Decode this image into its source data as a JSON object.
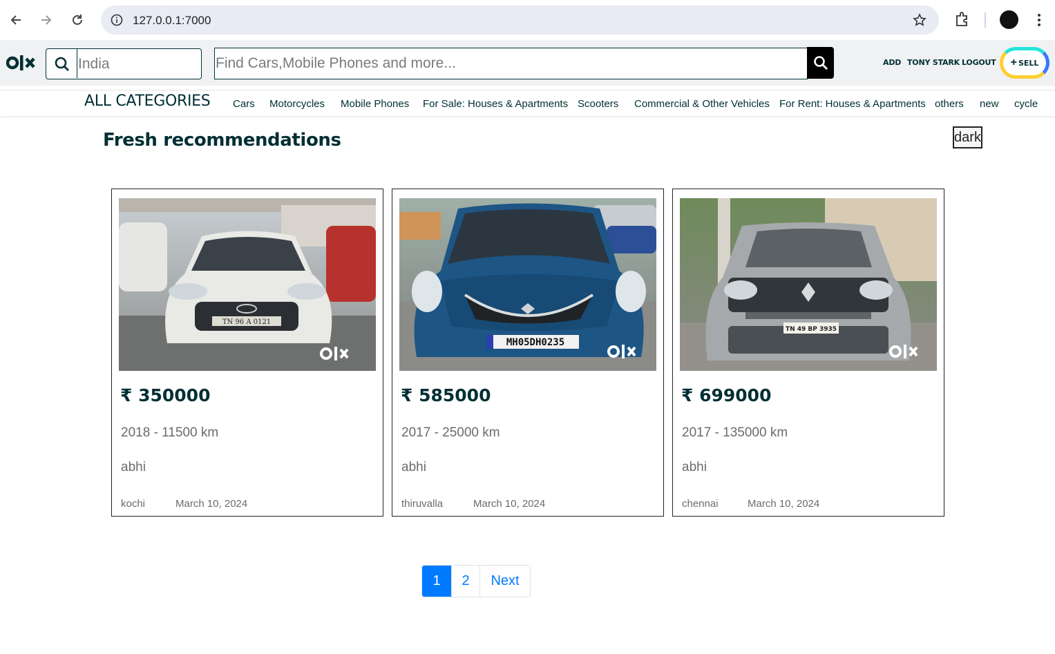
{
  "browser": {
    "url": "127.0.0.1:7000"
  },
  "header": {
    "location_value": "India",
    "search_placeholder": "Find Cars,Mobile Phones and more...",
    "links": [
      "ADD",
      "TONY STARK",
      "LOGOUT"
    ],
    "sell_label": "SELL",
    "sell_plus": "+"
  },
  "categories": {
    "all_label": "ALL CATEGORIES",
    "items": [
      "Cars",
      "Motorcycles",
      "Mobile Phones",
      "For Sale: Houses & Apartments",
      "Scooters",
      "Commercial & Other Vehicles",
      "For Rent: Houses & Apartments",
      "others",
      "new",
      "cycle"
    ]
  },
  "main": {
    "heading": "Fresh recommendations",
    "theme_button": "dark"
  },
  "listings": [
    {
      "price": "₹ 350000",
      "meta": "2018 - 11500 km",
      "owner": "abhi",
      "city": "kochi",
      "date": "March 10, 2024",
      "car_color": "#e9e9e6",
      "plate": "TN 96  A  0121",
      "brand": "hyundai"
    },
    {
      "price": "₹ 585000",
      "meta": "2017 - 25000 km",
      "owner": "abhi",
      "city": "thiruvalla",
      "date": "March 10, 2024",
      "car_color": "#1d5585",
      "plate": "MH05DH0235",
      "brand": "suzuki"
    },
    {
      "price": "₹ 699000",
      "meta": "2017 - 135000 km",
      "owner": "abhi",
      "city": "chennai",
      "date": "March 10, 2024",
      "car_color": "#a6a9ab",
      "plate": "TN 49 BP 3935",
      "brand": "renault"
    }
  ],
  "pagination": {
    "pages": [
      "1",
      "2"
    ],
    "next_label": "Next",
    "active_page": "1"
  },
  "colors": {
    "olx_dark": "#002f34",
    "pager_blue": "#007bff",
    "sell_cyan": "#23e5db",
    "sell_blue": "#3a77ff",
    "sell_yellow": "#ffce32"
  }
}
